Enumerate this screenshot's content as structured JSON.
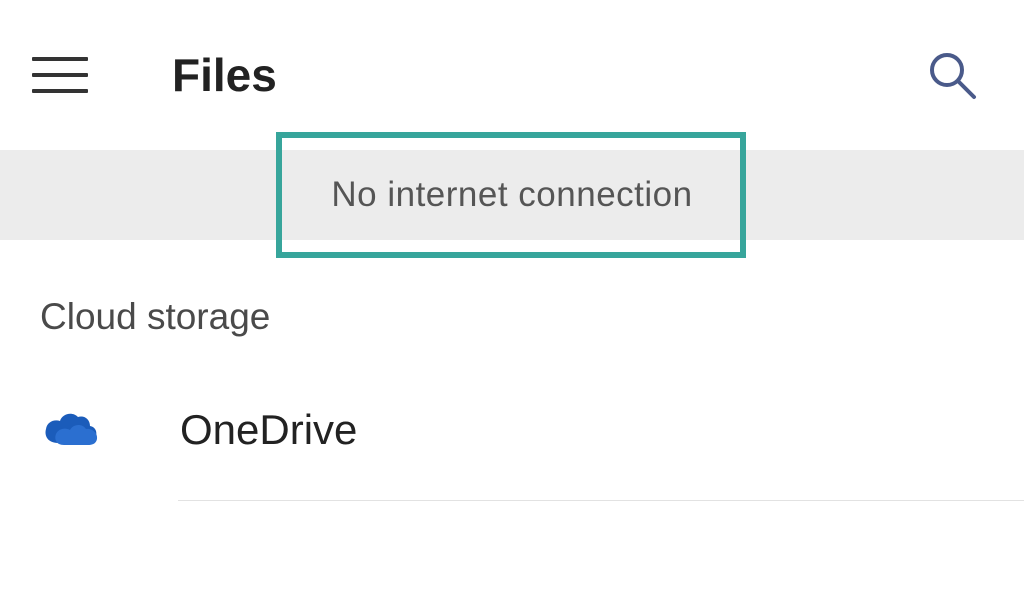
{
  "header": {
    "title": "Files"
  },
  "banner": {
    "message": "No internet connection",
    "highlight_color": "#37a59b"
  },
  "section": {
    "title": "Cloud storage",
    "items": [
      {
        "label": "OneDrive",
        "icon": "onedrive-icon",
        "color": "#1b5cba"
      }
    ]
  },
  "icons": {
    "hamburger": "hamburger-icon",
    "search": "search-icon"
  }
}
